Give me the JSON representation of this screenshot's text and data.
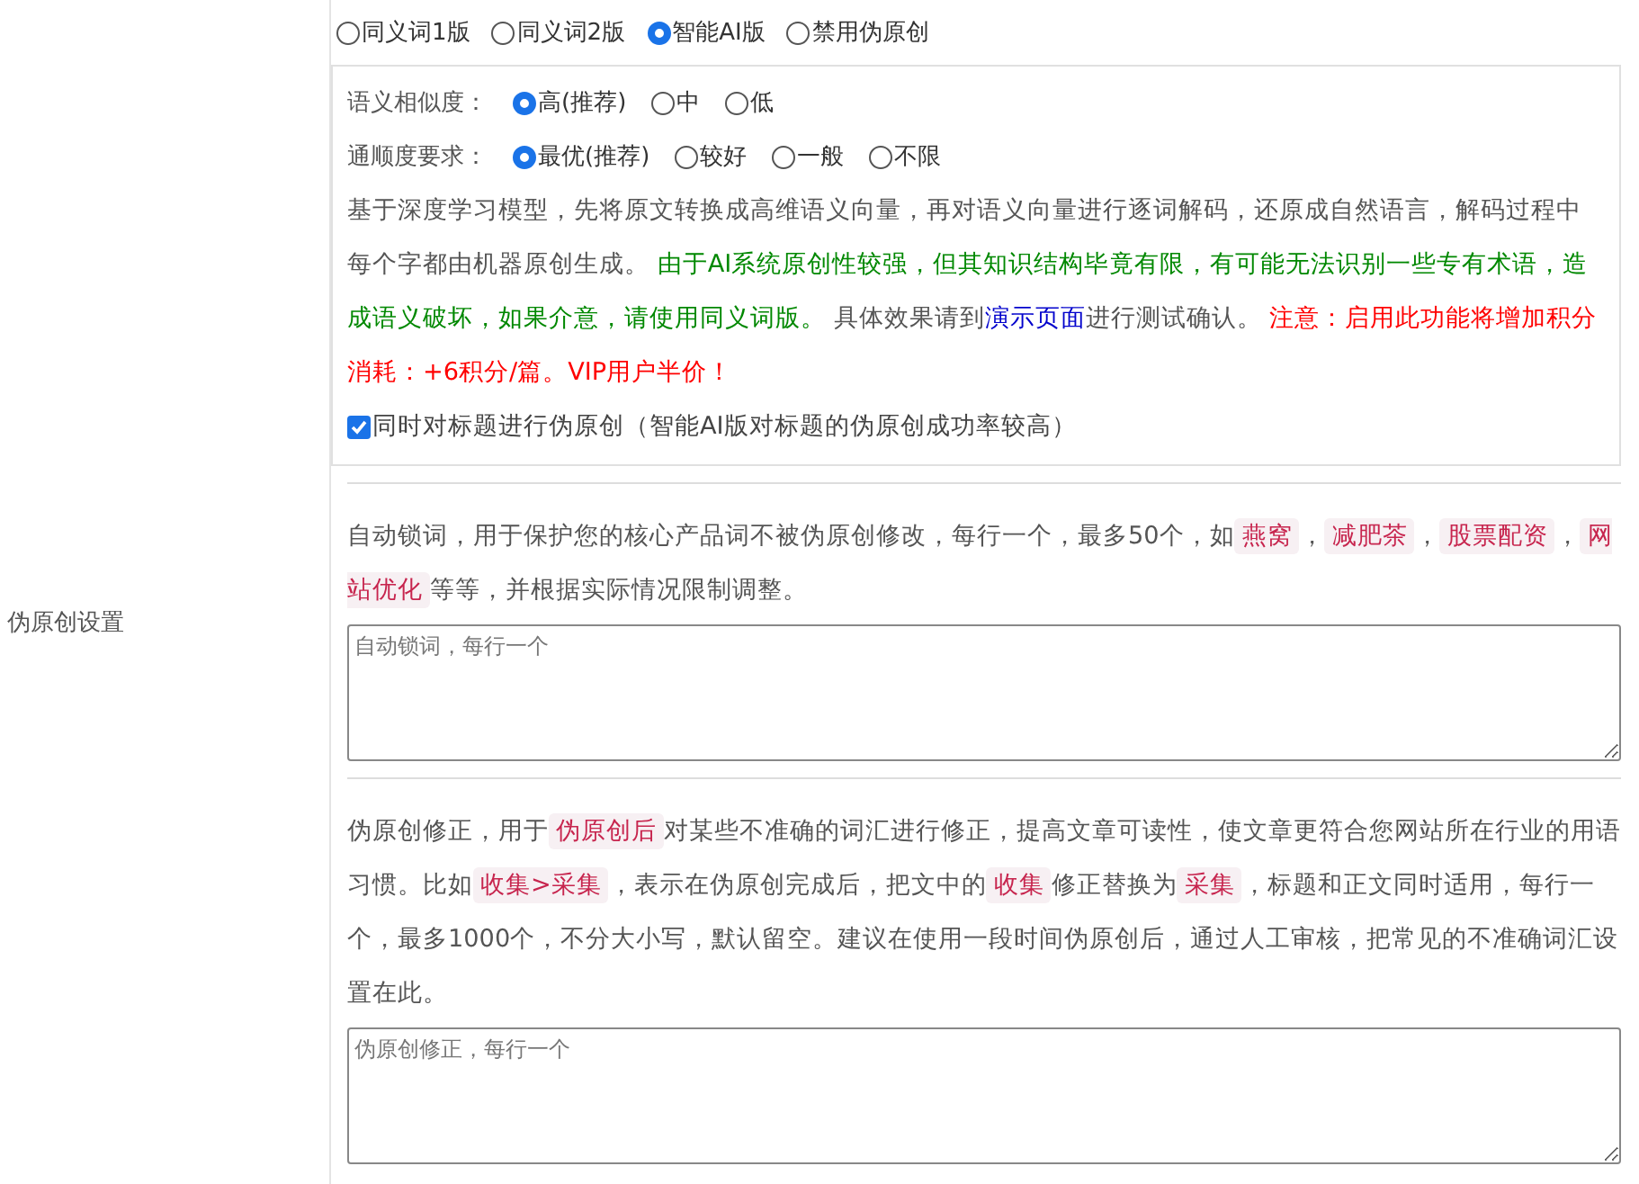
{
  "version_options": [
    {
      "label": "同义词1版",
      "selected": false
    },
    {
      "label": "同义词2版",
      "selected": false
    },
    {
      "label": "智能AI版",
      "selected": true
    },
    {
      "label": "禁用伪原创",
      "selected": false
    }
  ],
  "ai_panel": {
    "option_groups": [
      {
        "label": "语义相似度：",
        "options": [
          {
            "label": "高(推荐)",
            "selected": true
          },
          {
            "label": "中",
            "selected": false
          },
          {
            "label": "低",
            "selected": false
          }
        ]
      },
      {
        "label": "通顺度要求：",
        "options": [
          {
            "label": "最优(推荐)",
            "selected": true
          },
          {
            "label": "较好",
            "selected": false
          },
          {
            "label": "一般",
            "selected": false
          },
          {
            "label": "不限",
            "selected": false
          }
        ]
      }
    ],
    "description": [
      {
        "kind": "plain",
        "text": "基于深度学习模型，先将原文转换成高维语义向量，再对语义向量进行逐词解码，还原成自然语言，解码过程中每个字都由机器原创生成。 "
      },
      {
        "kind": "note",
        "text": "由于AI系统原创性较强，但其知识结构毕竟有限，有可能无法识别一些专有术语，造成语义破坏，如果介意，请使用同义词版。 "
      },
      {
        "kind": "plain",
        "text": "具体效果请到"
      },
      {
        "kind": "link",
        "text": "演示页面"
      },
      {
        "kind": "plain",
        "text": "进行测试确认。 "
      },
      {
        "kind": "warning",
        "text": "注意：启用此功能将增加积分消耗：+6积分/篇。VIP用户半价！"
      }
    ],
    "title_checkbox": {
      "label": "同时对标题进行伪原创（智能AI版对标题的伪原创成功率较高）",
      "checked": true
    }
  },
  "settings_label": "伪原创设置",
  "lock_words": {
    "segments": [
      {
        "kind": "text",
        "text": "自动锁词，用于保护您的核心产品词不被伪原创修改，每行一个，最多50个，如"
      },
      {
        "kind": "tag",
        "text": "燕窝"
      },
      {
        "kind": "text",
        "text": "，"
      },
      {
        "kind": "tag",
        "text": "减肥茶"
      },
      {
        "kind": "text",
        "text": "，"
      },
      {
        "kind": "tag",
        "text": "股票配资"
      },
      {
        "kind": "text",
        "text": "，"
      },
      {
        "kind": "tag",
        "text": "网站优化"
      },
      {
        "kind": "text",
        "text": "等等，并根据实际情况限制调整。"
      }
    ],
    "placeholder": "自动锁词，每行一个"
  },
  "corrections": {
    "segments": [
      {
        "kind": "text",
        "text": "伪原创修正，用于"
      },
      {
        "kind": "tag",
        "text": "伪原创后"
      },
      {
        "kind": "text",
        "text": "对某些不准确的词汇进行修正，提高文章可读性，使文章更符合您网站所在行业的用语习惯。比如"
      },
      {
        "kind": "tag",
        "text": "收集>采集"
      },
      {
        "kind": "text",
        "text": "，表示在伪原创完成后，把文中的"
      },
      {
        "kind": "tag",
        "text": "收集"
      },
      {
        "kind": "text",
        "text": "修正替换为"
      },
      {
        "kind": "tag",
        "text": "采集"
      },
      {
        "kind": "text",
        "text": "，标题和正文同时适用，每行一个，最多1000个，不分大小写，默认留空。建议在使用一段时间伪原创后，通过人工审核，把常见的不准确词汇设置在此。"
      }
    ],
    "placeholder": "伪原创修正，每行一个"
  }
}
